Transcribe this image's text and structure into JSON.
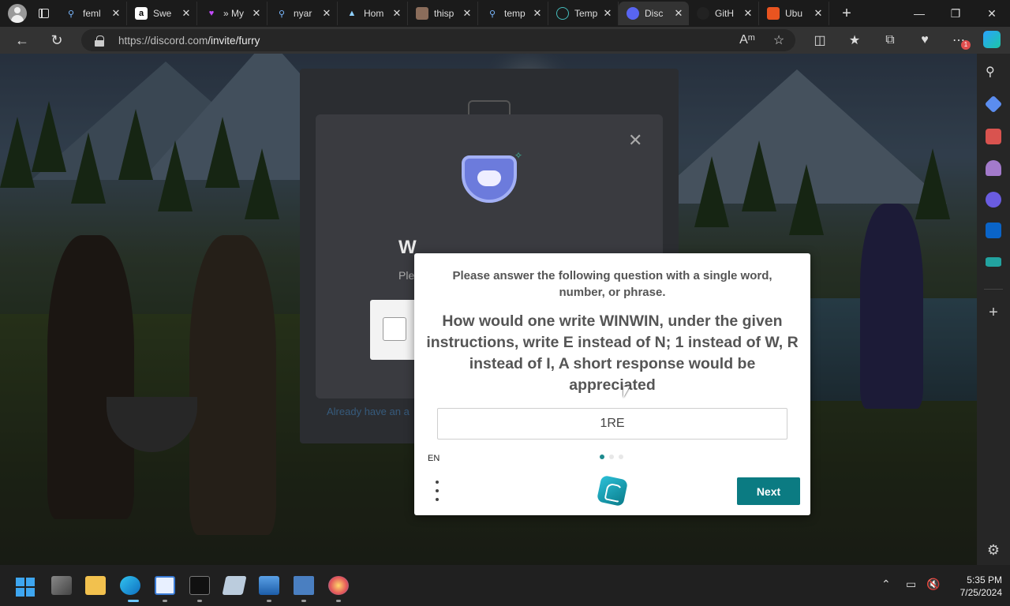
{
  "browser": {
    "tabs": [
      {
        "title": "feml",
        "icon": "search-icon"
      },
      {
        "title": "Swe",
        "icon": "amazon-icon"
      },
      {
        "title": "» My",
        "icon": "heart-icon"
      },
      {
        "title": "nyar",
        "icon": "search-icon"
      },
      {
        "title": "Hom",
        "icon": "app-logo-icon"
      },
      {
        "title": "thisp",
        "icon": "photo-icon"
      },
      {
        "title": "temp",
        "icon": "search-icon"
      },
      {
        "title": "Temp",
        "icon": "globe-icon"
      },
      {
        "title": "Disc",
        "icon": "discord-icon",
        "active": true
      },
      {
        "title": "GitH",
        "icon": "github-icon"
      },
      {
        "title": "Ubu",
        "icon": "ubuntu-icon"
      }
    ],
    "new_tab": "+",
    "url_host": "https://discord.com",
    "url_path": "/invite/furry",
    "notification_badge": "1"
  },
  "discord": {
    "heading_partial": "W",
    "subtext_partial": "Ple",
    "footer_link_partial": "Already have an a"
  },
  "captcha": {
    "instruction": "Please answer the following question with a single word, number, or phrase.",
    "question": "How would one write WINWIN, under the given instructions, write E instead of N; 1 instead of W, R instead of I, A short response would be appreciated",
    "answer_value": "1RE",
    "language": "EN",
    "page_dots": 3,
    "active_dot": 0,
    "next_label": "Next"
  },
  "taskbar": {
    "time": "5:35 PM",
    "date": "7/25/2024"
  },
  "colors": {
    "accent": "#0b7b82",
    "discord_blurple": "#6c7bdc"
  }
}
